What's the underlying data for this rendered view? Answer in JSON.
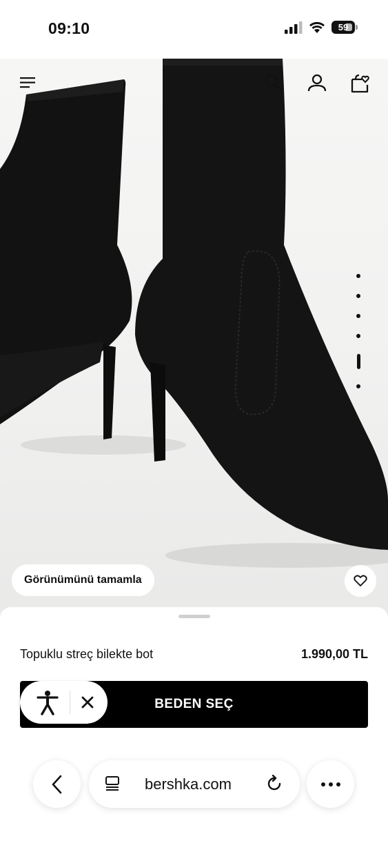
{
  "status_bar": {
    "time": "09:10",
    "battery": "59"
  },
  "header": {
    "menu_icon": "menu-icon",
    "search_icon": "search-icon",
    "account_icon": "user-icon",
    "bag_icon": "shopping-bag-heart-icon"
  },
  "gallery": {
    "slide_count": 6,
    "active_index": 4
  },
  "complete_look": {
    "label": "Görünümünü tamamla"
  },
  "wishlist": {
    "icon": "heart-icon"
  },
  "product": {
    "name": "Topuklu streç bilekte bot",
    "price": "1.990,00 TL"
  },
  "cta": {
    "label": "BEDEN SEÇ"
  },
  "accessibility": {
    "icon": "accessibility-icon",
    "close_icon": "close-icon"
  },
  "browser": {
    "url": "bershka.com",
    "back_icon": "chevron-left-icon",
    "reader_icon": "reader-icon",
    "reload_icon": "reload-icon",
    "more_icon": "more-icon"
  },
  "colors": {
    "accent": "#000000",
    "background": "#ffffff",
    "image_bg": "#f1f1f0"
  }
}
